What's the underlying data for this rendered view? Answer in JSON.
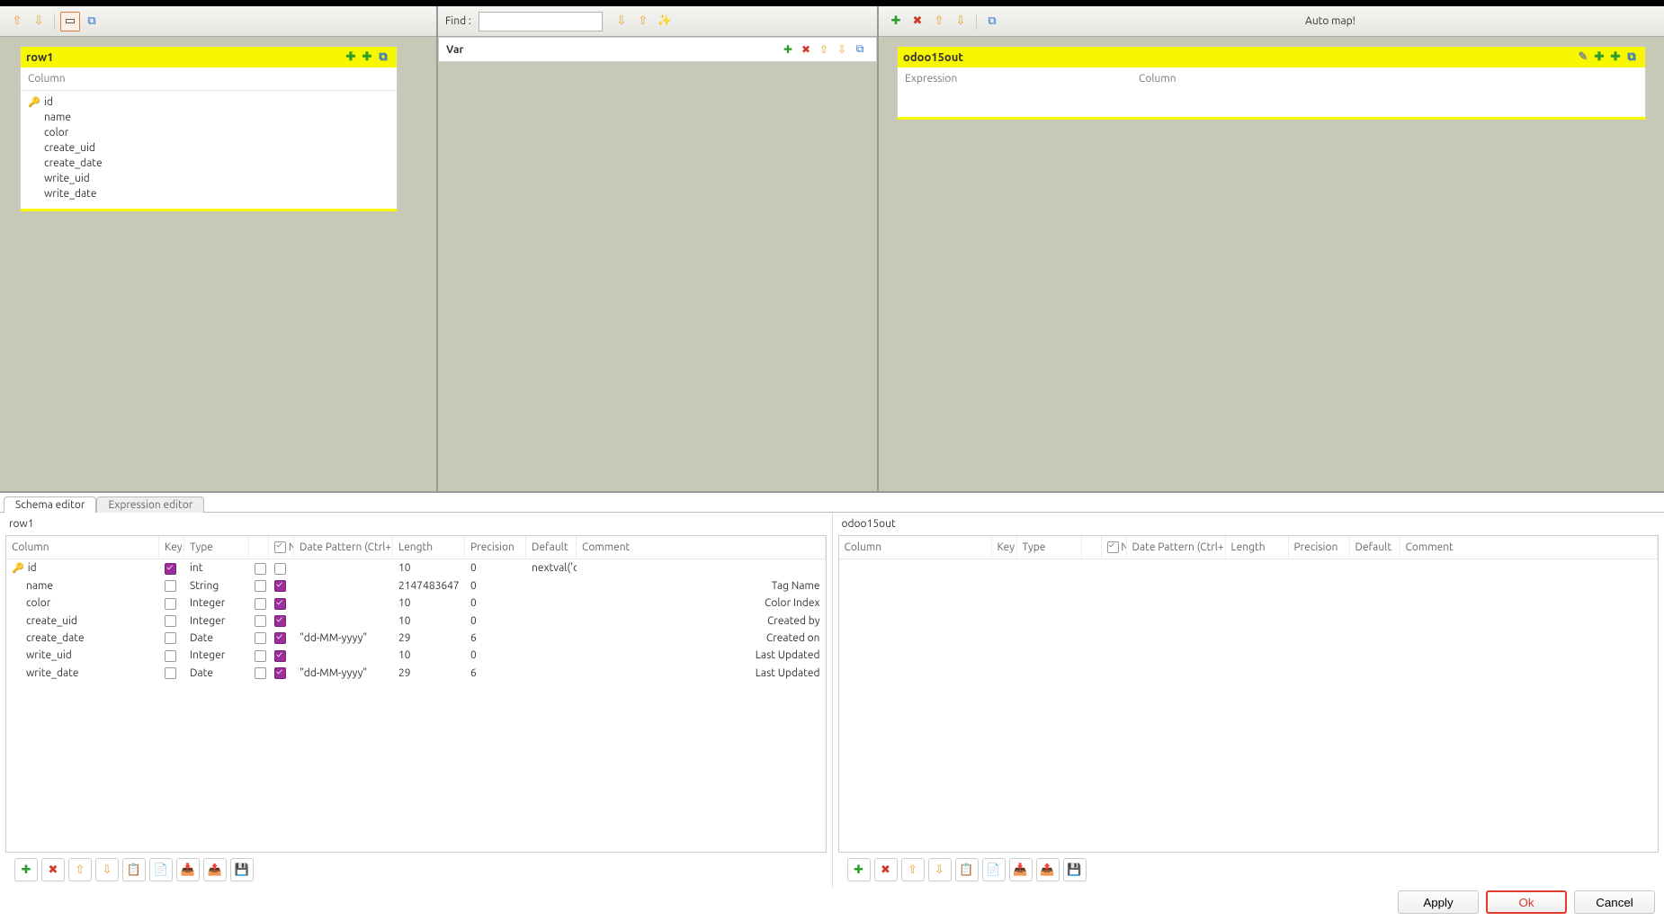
{
  "left_panel": {
    "card_title": "row1",
    "column_header": "Column",
    "columns": [
      {
        "name": "id",
        "key": true
      },
      {
        "name": "name",
        "key": false
      },
      {
        "name": "color",
        "key": false
      },
      {
        "name": "create_uid",
        "key": false
      },
      {
        "name": "create_date",
        "key": false
      },
      {
        "name": "write_uid",
        "key": false
      },
      {
        "name": "write_date",
        "key": false
      }
    ]
  },
  "mid_panel": {
    "find_label": "Find :",
    "var_label": "Var"
  },
  "right_panel": {
    "auto_map": "Auto map!",
    "card_title": "odoo15out",
    "expr_header": "Expression",
    "col_header": "Column"
  },
  "tabs": {
    "schema": "Schema editor",
    "expr": "Expression editor"
  },
  "schema_left": {
    "title": "row1",
    "columns": [
      "Column",
      "Key",
      "Type",
      "",
      "Null",
      "Date Pattern (Ctrl+",
      "Length",
      "Precision",
      "Default",
      "Comment"
    ],
    "rows": [
      {
        "name": "id",
        "key": true,
        "type": "int",
        "x": false,
        "nullable": false,
        "pattern": "",
        "pat_gray": true,
        "length": "10",
        "precision": "0",
        "default": "nextval('c",
        "comment": ""
      },
      {
        "name": "name",
        "key": false,
        "type": "String",
        "x": false,
        "nullable": true,
        "pattern": "",
        "pat_gray": true,
        "length": "2147483647",
        "precision": "0",
        "default": "",
        "comment": "Tag Name"
      },
      {
        "name": "color",
        "key": false,
        "type": "Integer",
        "x": false,
        "nullable": true,
        "pattern": "",
        "pat_gray": true,
        "length": "10",
        "precision": "0",
        "default": "",
        "comment": "Color Index"
      },
      {
        "name": "create_uid",
        "key": false,
        "type": "Integer",
        "x": false,
        "nullable": true,
        "pattern": "",
        "pat_gray": true,
        "length": "10",
        "precision": "0",
        "default": "",
        "comment": "Created by"
      },
      {
        "name": "create_date",
        "key": false,
        "type": "Date",
        "x": false,
        "nullable": true,
        "pattern": "\"dd-MM-yyyy\"",
        "pat_gray": false,
        "length": "29",
        "precision": "6",
        "default": "",
        "comment": "Created on"
      },
      {
        "name": "write_uid",
        "key": false,
        "type": "Integer",
        "x": false,
        "nullable": true,
        "pattern": "",
        "pat_gray": true,
        "length": "10",
        "precision": "0",
        "default": "",
        "comment": "Last Updated"
      },
      {
        "name": "write_date",
        "key": false,
        "type": "Date",
        "x": false,
        "nullable": true,
        "pattern": "\"dd-MM-yyyy\"",
        "pat_gray": false,
        "length": "29",
        "precision": "6",
        "default": "",
        "comment": "Last Updated"
      }
    ]
  },
  "schema_right": {
    "title": "odoo15out",
    "columns": [
      "Column",
      "Key",
      "Type",
      "",
      "Null",
      "Date Pattern (Ctrl+",
      "Length",
      "Precision",
      "Default",
      "Comment"
    ]
  },
  "footer": {
    "apply": "Apply",
    "ok": "Ok",
    "cancel": "Cancel"
  }
}
